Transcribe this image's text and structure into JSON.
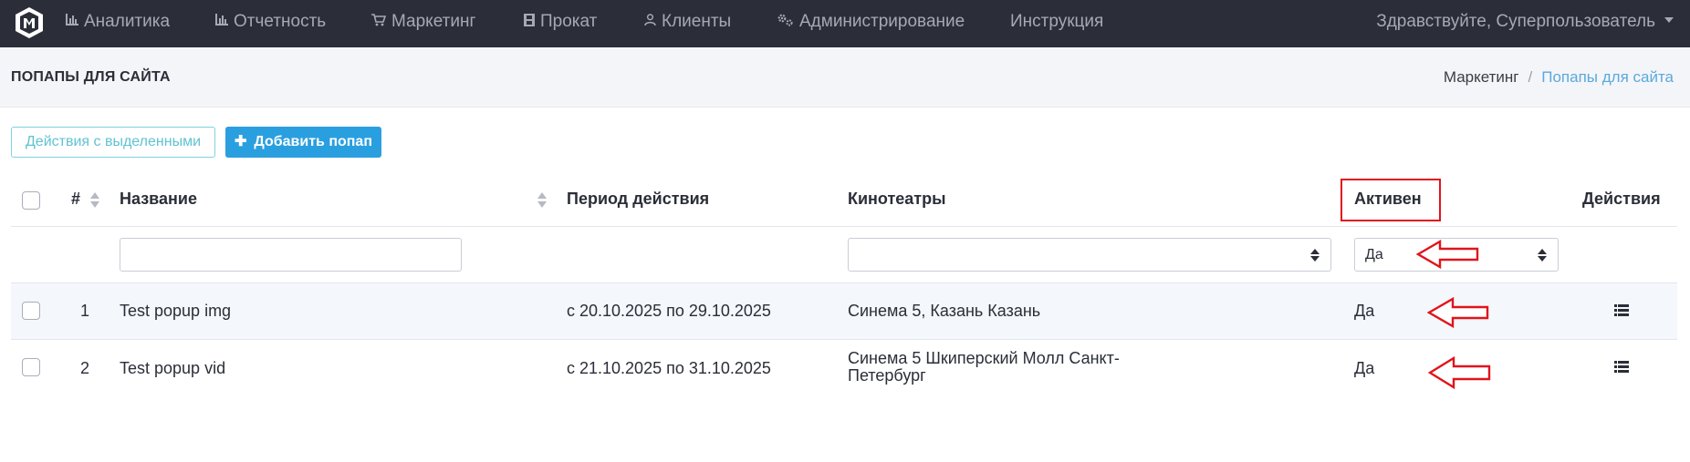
{
  "nav": {
    "items": [
      {
        "id": "analytics",
        "label": "Аналитика",
        "icon": "bar-chart-icon"
      },
      {
        "id": "reports",
        "label": "Отчетность",
        "icon": "bar-chart-icon"
      },
      {
        "id": "marketing",
        "label": "Маркетинг",
        "icon": "cart-icon"
      },
      {
        "id": "rental",
        "label": "Прокат",
        "icon": "film-icon"
      },
      {
        "id": "clients",
        "label": "Клиенты",
        "icon": "user-icon"
      },
      {
        "id": "admin",
        "label": "Администрирование",
        "icon": "gears-icon"
      },
      {
        "id": "manual",
        "label": "Инструкция",
        "icon": ""
      }
    ],
    "user_greeting": "Здравствуйте, Суперпользователь"
  },
  "header": {
    "title": "ПОПАПЫ ДЛЯ САЙТА",
    "breadcrumb": {
      "root": "Маркетинг",
      "separator": "/",
      "current": "Попапы для сайта"
    }
  },
  "toolbar": {
    "bulk_actions_label": "Действия с выделенными",
    "add_label": "Добавить попап"
  },
  "table": {
    "columns": {
      "number": "#",
      "name": "Название",
      "period": "Период действия",
      "cinemas": "Кинотеатры",
      "active": "Активен",
      "actions": "Действия"
    },
    "filters": {
      "name_value": "",
      "cinemas_value": "",
      "active_value": "Да"
    },
    "rows": [
      {
        "num": "1",
        "name": "Test popup img",
        "period": "с 20.10.2025 по 29.10.2025",
        "cinemas": "Синема 5, Казань Казань",
        "active": "Да"
      },
      {
        "num": "2",
        "name": "Test popup vid",
        "period": "с 21.10.2025 по 31.10.2025",
        "cinemas": "Синема 5 Шкиперский Молл Санкт-Петербург",
        "active": "Да"
      }
    ]
  },
  "colors": {
    "navbar": "#2b2e38",
    "accent": "#2a9fe0",
    "annotation": "#e0141b"
  }
}
